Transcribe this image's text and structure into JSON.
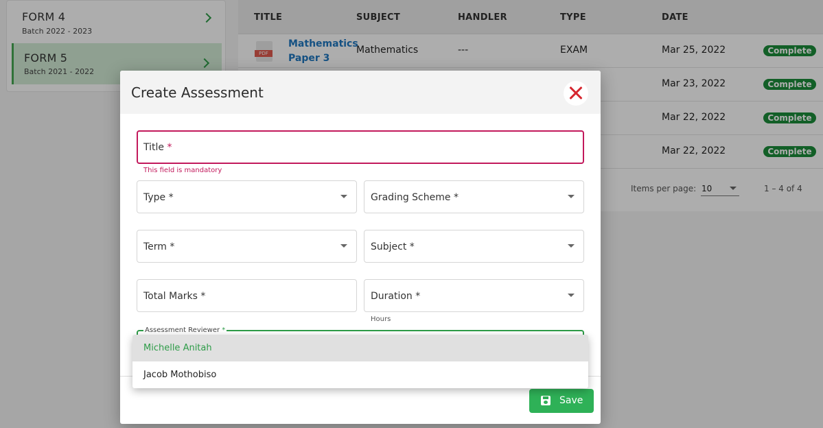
{
  "batches": [
    {
      "title": "FORM 4",
      "subtitle": "Batch  2022 - 2023",
      "active": false
    },
    {
      "title": "FORM 5",
      "subtitle": "Batch 2021 - 2022",
      "active": true
    }
  ],
  "table": {
    "headers": [
      "TITLE",
      "SUBJECT",
      "HANDLER",
      "TYPE",
      "DATE"
    ],
    "rows": [
      {
        "icon": "PDF",
        "title": "Mathematics Paper 3",
        "subject": "Mathematics",
        "handler": "---",
        "type": "EXAM",
        "date": "Mar 25, 2022",
        "status": "Complete"
      },
      {
        "date": "Mar 23, 2022",
        "status": "Complete"
      },
      {
        "date": "Mar 22, 2022",
        "status": "Complete"
      },
      {
        "date": "Mar 22, 2022",
        "status": "Complete"
      }
    ]
  },
  "pager": {
    "label": "Items per page:",
    "value": "10",
    "range": "1 – 4 of 4"
  },
  "dialog": {
    "title": "Create Assessment",
    "title_field": {
      "label": "Title",
      "required": "*",
      "error": "This field is mandatory"
    },
    "type_label": "Type *",
    "grading_label": "Grading Scheme *",
    "term_label": "Term *",
    "subject_label": "Subject *",
    "total_marks_label": "Total Marks *",
    "duration_label": "Duration *",
    "duration_hint": "Hours",
    "reviewer_label": "Assessment Reviewer",
    "reviewer_required": "*",
    "save_label": "Save"
  },
  "reviewer_options": [
    {
      "label": "Michelle Anitah",
      "selected": true
    },
    {
      "label": "Jacob Mothobiso",
      "selected": false
    }
  ],
  "colors": {
    "accent": "#2eb157",
    "error": "#c2185b",
    "close": "#d6262f",
    "status": "#1b8d3a",
    "link": "#1f78c1"
  }
}
